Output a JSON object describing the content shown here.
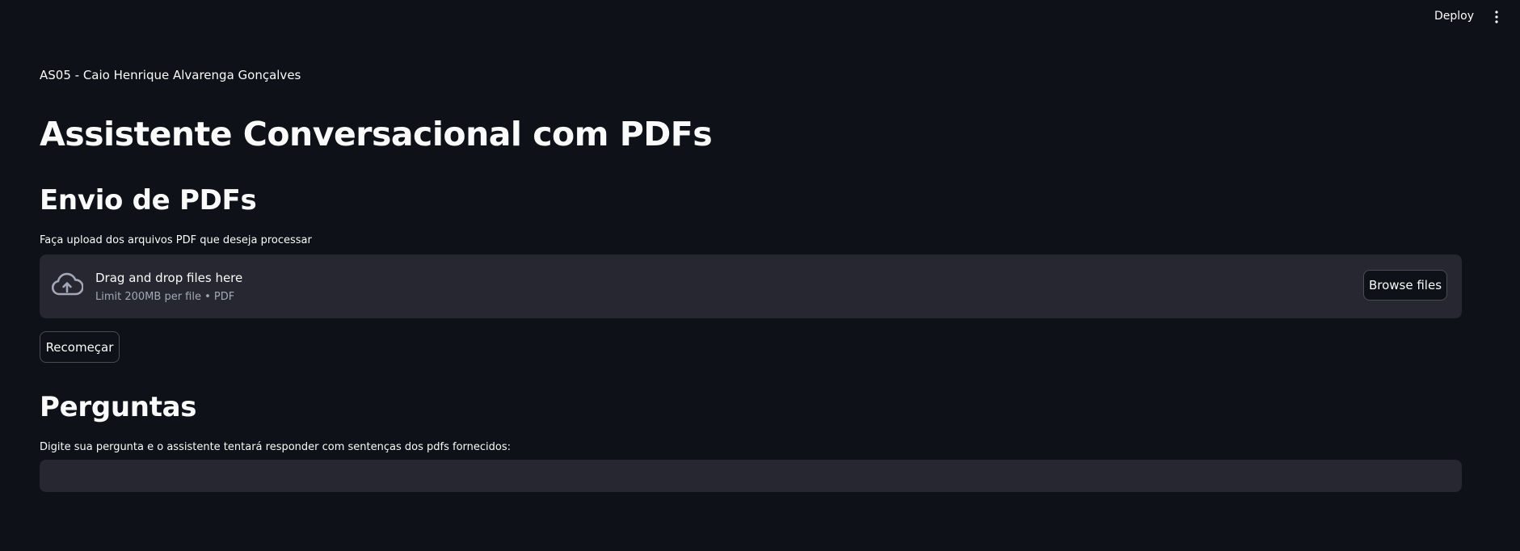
{
  "header": {
    "deploy_label": "Deploy",
    "menu_icon": "more-vertical-icon"
  },
  "main": {
    "top_text": "AS05 - Caio Henrique Alvarenga Gonçalves",
    "title": "Assistente Conversacional com PDFs",
    "upload_section": {
      "heading": "Envio de PDFs",
      "label": "Faça upload dos arquivos PDF que deseja processar",
      "dropzone_text": "Drag and drop files here",
      "dropzone_limit": "Limit 200MB per file • PDF",
      "dropzone_icon": "cloud-upload-icon",
      "browse_label": "Browse files"
    },
    "restart_label": "Recomeçar",
    "questions_section": {
      "heading": "Perguntas",
      "label": "Digite sua pergunta e o assistente tentará responder com sentenças dos pdfs fornecidos:",
      "input_value": "",
      "input_placeholder": ""
    }
  },
  "colors": {
    "background": "#0e1117",
    "surface": "#262730",
    "text": "#fafafa",
    "muted_text": "#a3a8b8",
    "border": "#4a4c55"
  }
}
